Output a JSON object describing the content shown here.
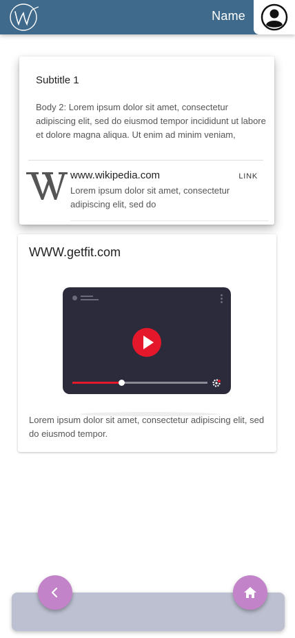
{
  "header": {
    "name": "Name",
    "logo_icon": "script-w-logo-icon",
    "avatar_icon": "user-avatar-icon",
    "background": "#3f6a8c"
  },
  "card1": {
    "subtitle": "Subtitle 1",
    "body": "Body 2: Lorem ipsum dolor sit amet, consectetur adipiscing elit, sed do eiusmod tempor incididunt ut labore et dolore magna aliqua. Ut enim ad minim veniam,",
    "link": {
      "icon": "wikipedia-w-icon",
      "title": "www.wikipedia.com",
      "description": "Lorem ipsum dolor sit amet, consectetur adipiscing elit, sed do",
      "action": "LINK"
    }
  },
  "card2": {
    "title": "WWW.getfit.com",
    "video": {
      "icon": "play-icon",
      "progress": 0.36,
      "accent": "#e5182b"
    },
    "text": "Lorem ipsum dolor sit amet, consectetur adipiscing elit, sed do eiusmod tempor."
  },
  "bottom_nav": {
    "back_icon": "chevron-left-icon",
    "home_icon": "home-icon",
    "fab_color": "#c283c8",
    "bar_color": "#bcc0d0"
  }
}
